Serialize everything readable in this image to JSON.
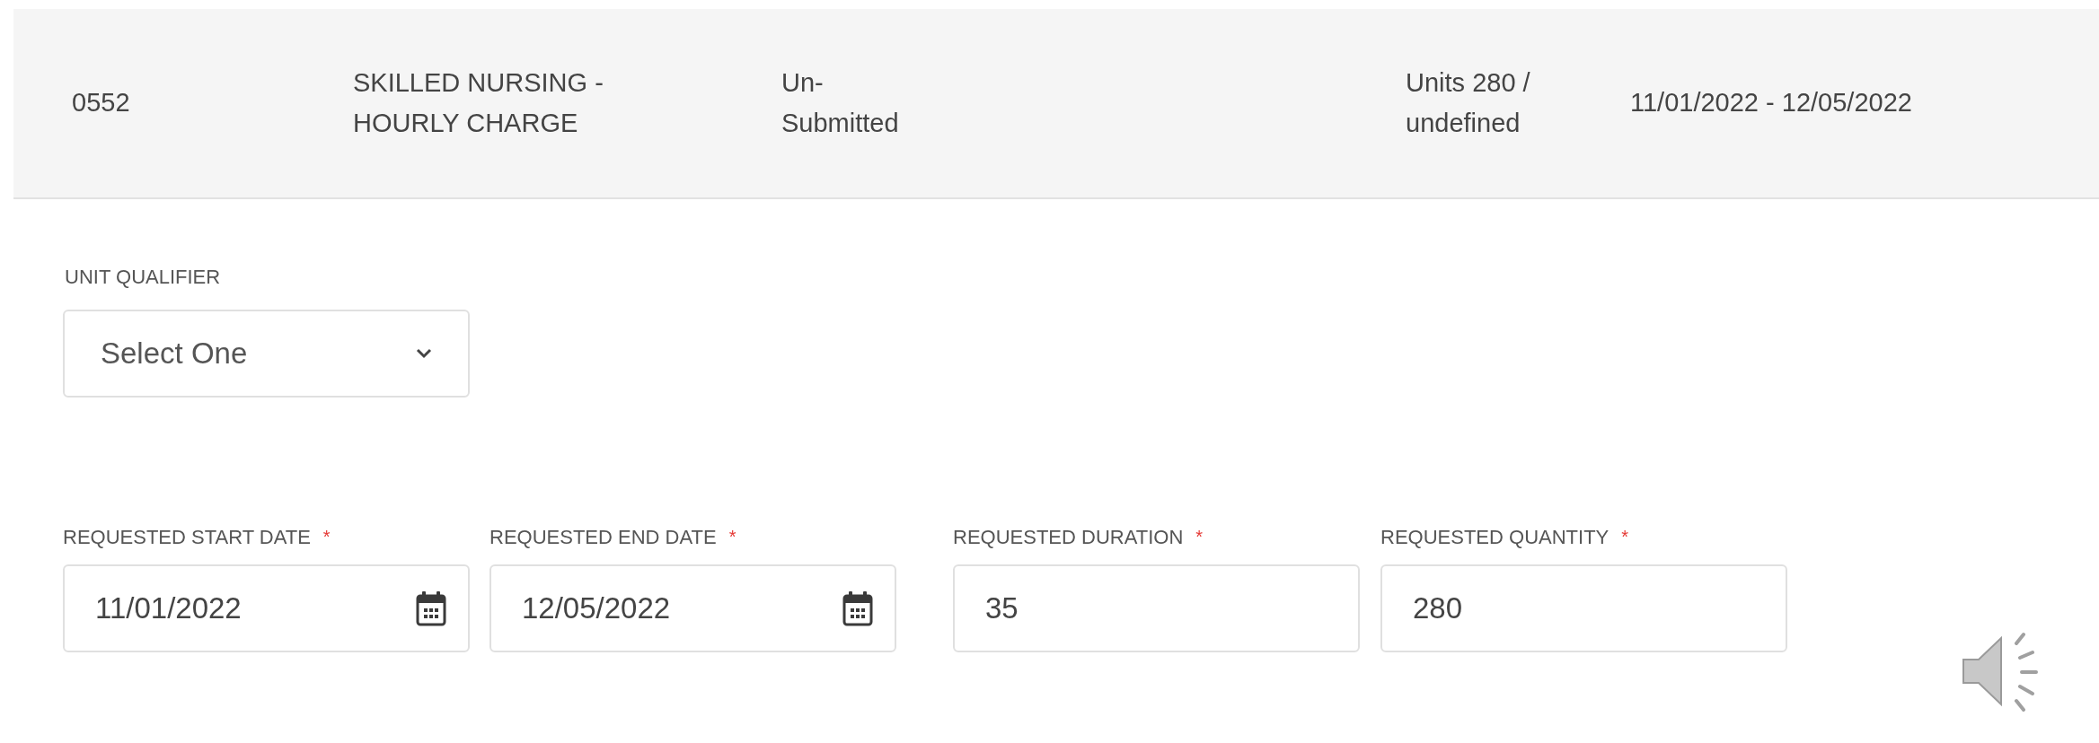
{
  "summary_row": {
    "code": "0552",
    "service": [
      "SKILLED NURSING -",
      "HOURLY CHARGE"
    ],
    "status": [
      "Un-",
      "Submitted"
    ],
    "units": [
      "Units 280 /",
      "undefined"
    ],
    "date_range": "11/01/2022 - 12/05/2022"
  },
  "unit_qualifier": {
    "label": "UNIT QUALIFIER",
    "value": "Select One"
  },
  "fields": [
    {
      "label": "REQUESTED START DATE",
      "required_mark": "*",
      "value": "11/01/2022",
      "kind": "date"
    },
    {
      "label": "REQUESTED END DATE",
      "required_mark": "*",
      "value": "12/05/2022",
      "kind": "date"
    },
    {
      "label": "REQUESTED DURATION",
      "required_mark": "*",
      "value": "35",
      "kind": "text"
    },
    {
      "label": "REQUESTED QUANTITY",
      "required_mark": "*",
      "value": "280",
      "kind": "text"
    }
  ]
}
